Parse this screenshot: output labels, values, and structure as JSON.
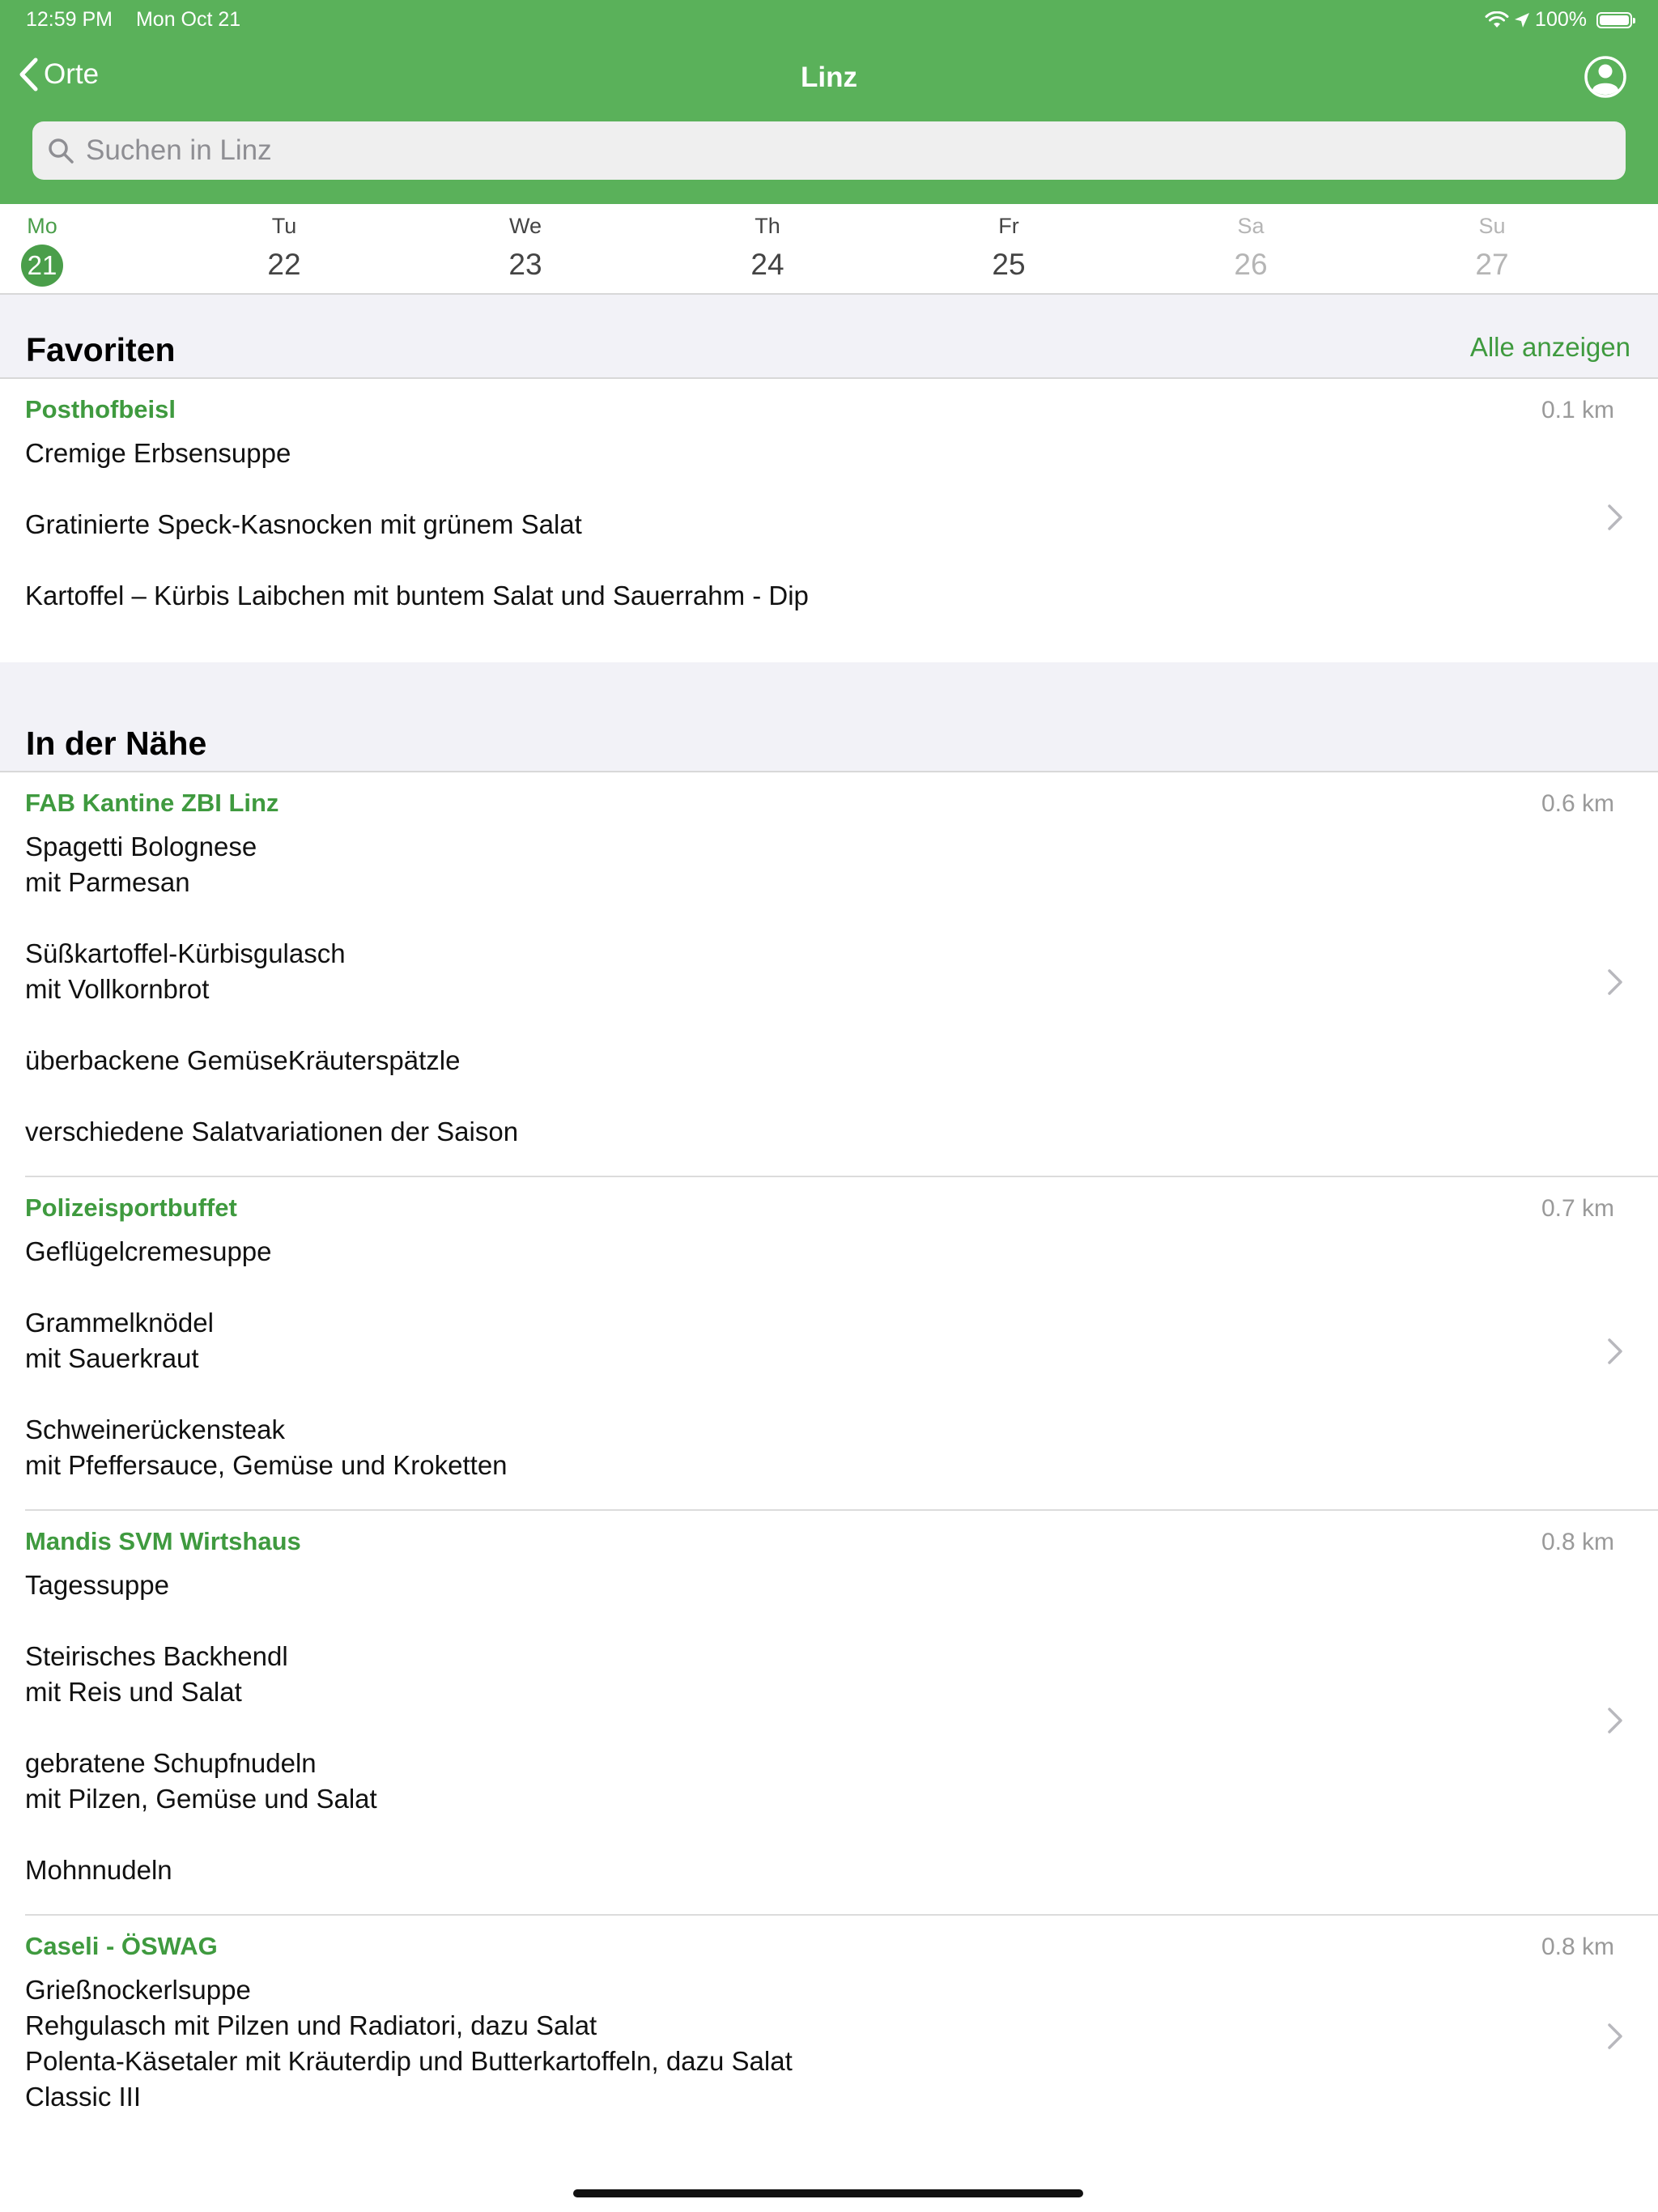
{
  "status_bar": {
    "time": "12:59 PM",
    "date": "Mon Oct 21",
    "battery": "100%",
    "battery_level": 1.0
  },
  "nav": {
    "back_label": "Orte",
    "title": "Linz"
  },
  "search": {
    "placeholder": "Suchen in Linz",
    "value": ""
  },
  "days": [
    {
      "name": "Mo",
      "num": "21",
      "selected": true,
      "weekend": false
    },
    {
      "name": "Tu",
      "num": "22",
      "selected": false,
      "weekend": false
    },
    {
      "name": "We",
      "num": "23",
      "selected": false,
      "weekend": false
    },
    {
      "name": "Th",
      "num": "24",
      "selected": false,
      "weekend": false
    },
    {
      "name": "Fr",
      "num": "25",
      "selected": false,
      "weekend": false
    },
    {
      "name": "Sa",
      "num": "26",
      "selected": false,
      "weekend": true
    },
    {
      "name": "Su",
      "num": "27",
      "selected": false,
      "weekend": true
    }
  ],
  "favorites": {
    "title": "Favoriten",
    "show_all": "Alle anzeigen",
    "items": [
      {
        "name": "Posthofbeisl",
        "distance": "0.1 km",
        "meals": [
          "Cremige Erbsensuppe",
          "",
          "Gratinierte Speck-Kasnocken mit grünem Salat",
          "",
          "Kartoffel – Kürbis Laibchen mit buntem Salat und Sauerrahm - Dip"
        ]
      }
    ]
  },
  "nearby": {
    "title": "In der Nähe",
    "items": [
      {
        "name": "FAB Kantine ZBI Linz",
        "distance": "0.6 km",
        "meals": [
          "Spagetti Bolognese",
          "mit Parmesan",
          "",
          "Süßkartoffel-Kürbisgulasch",
          "mit Vollkornbrot",
          "",
          "überbackene GemüseKräuterspätzle",
          "",
          "verschiedene Salatvariationen der Saison"
        ]
      },
      {
        "name": "Polizeisportbuffet",
        "distance": "0.7 km",
        "meals": [
          "Geflügelcremesuppe",
          "",
          "Grammelknödel",
          "mit Sauerkraut",
          "",
          "Schweinerückensteak",
          "mit Pfeffersauce, Gemüse und Kroketten"
        ]
      },
      {
        "name": "Mandis SVM Wirtshaus",
        "distance": "0.8 km",
        "meals": [
          "Tagessuppe",
          "",
          "Steirisches Backhendl",
          "mit Reis und Salat",
          "",
          "gebratene Schupfnudeln",
          "mit Pilzen, Gemüse und Salat",
          "",
          "Mohnnudeln"
        ]
      },
      {
        "name": "Caseli - ÖSWAG",
        "distance": "0.8 km",
        "meals": [
          "Grießnockerlsuppe",
          "Rehgulasch mit Pilzen und Radiatori, dazu Salat",
          "Polenta-Käsetaler mit Kräuterdip und Butterkartoffeln, dazu Salat",
          "Classic III"
        ]
      }
    ]
  },
  "colors": {
    "accent": "#5ab15a",
    "link_green": "#3f9a3f",
    "section_bg": "#f2f2f7"
  }
}
